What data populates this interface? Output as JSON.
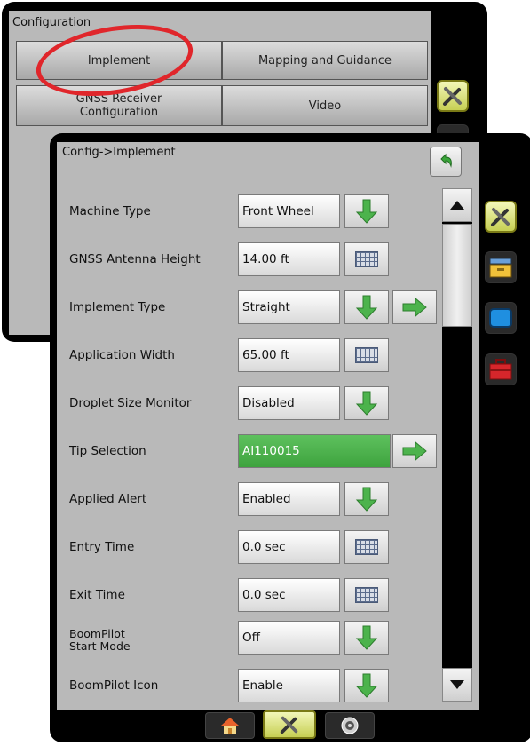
{
  "back_screen": {
    "title": "Configuration",
    "buttons": [
      "Implement",
      "Mapping and Guidance",
      "GNSS Receiver\nConfiguration",
      "Video"
    ]
  },
  "front_screen": {
    "breadcrumb": "Config->Implement",
    "rows": [
      {
        "label": "Machine Type",
        "value": "Front Wheel",
        "control": "dropdown"
      },
      {
        "label": "GNSS Antenna Height",
        "value": "14.00 ft",
        "control": "keyboard"
      },
      {
        "label": "Implement Type",
        "value": "Straight",
        "control": "dropdown",
        "next": true
      },
      {
        "label": "Application Width",
        "value": "65.00 ft",
        "control": "keyboard"
      },
      {
        "label": "Droplet Size Monitor",
        "value": "Disabled",
        "control": "dropdown"
      },
      {
        "label": "Tip Selection",
        "value": "AI110015",
        "control": "next"
      },
      {
        "label": "Applied Alert",
        "value": "Enabled",
        "control": "dropdown"
      },
      {
        "label": "Entry Time",
        "value": "0.0 sec",
        "control": "keyboard"
      },
      {
        "label": "Exit Time",
        "value": "0.0 sec",
        "control": "keyboard"
      },
      {
        "label": "BoomPilot\nStart Mode",
        "value": "Off",
        "control": "dropdown"
      },
      {
        "label": "BoomPilot Icon",
        "value": "Enable",
        "control": "dropdown"
      }
    ],
    "bottom_tabs": [
      "home-icon",
      "tools-icon",
      "gps-icon"
    ],
    "side_tabs": [
      "tools-icon",
      "folder-icon",
      "screen-icon",
      "toolbox-icon"
    ]
  },
  "colors": {
    "accent_green": "#4cb34c",
    "highlight_red": "#e0262b",
    "selected_tab": "#d9e07a"
  }
}
